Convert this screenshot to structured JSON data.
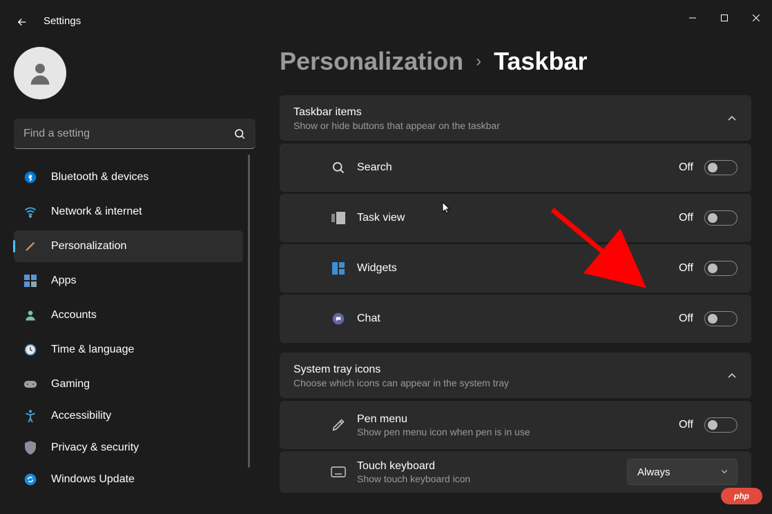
{
  "app": {
    "title": "Settings"
  },
  "search": {
    "placeholder": "Find a setting"
  },
  "nav": {
    "items": [
      {
        "id": "bluetooth",
        "label": "Bluetooth & devices"
      },
      {
        "id": "network",
        "label": "Network & internet"
      },
      {
        "id": "personalization",
        "label": "Personalization"
      },
      {
        "id": "apps",
        "label": "Apps"
      },
      {
        "id": "accounts",
        "label": "Accounts"
      },
      {
        "id": "time",
        "label": "Time & language"
      },
      {
        "id": "gaming",
        "label": "Gaming"
      },
      {
        "id": "accessibility",
        "label": "Accessibility"
      },
      {
        "id": "privacy",
        "label": "Privacy & security"
      },
      {
        "id": "update",
        "label": "Windows Update"
      }
    ],
    "active_index": 2
  },
  "breadcrumb": {
    "parent": "Personalization",
    "current": "Taskbar"
  },
  "sections": {
    "taskbar_items": {
      "title": "Taskbar items",
      "subtitle": "Show or hide buttons that appear on the taskbar",
      "items": [
        {
          "id": "search",
          "label": "Search",
          "state": "Off"
        },
        {
          "id": "taskview",
          "label": "Task view",
          "state": "Off"
        },
        {
          "id": "widgets",
          "label": "Widgets",
          "state": "Off"
        },
        {
          "id": "chat",
          "label": "Chat",
          "state": "Off"
        }
      ]
    },
    "tray_icons": {
      "title": "System tray icons",
      "subtitle": "Choose which icons can appear in the system tray",
      "items": [
        {
          "id": "pen",
          "label": "Pen menu",
          "sub": "Show pen menu icon when pen is in use",
          "state": "Off",
          "control": "toggle"
        },
        {
          "id": "touchkb",
          "label": "Touch keyboard",
          "sub": "Show touch keyboard icon",
          "value": "Always",
          "control": "select"
        }
      ]
    }
  },
  "badge": {
    "text": "php"
  }
}
